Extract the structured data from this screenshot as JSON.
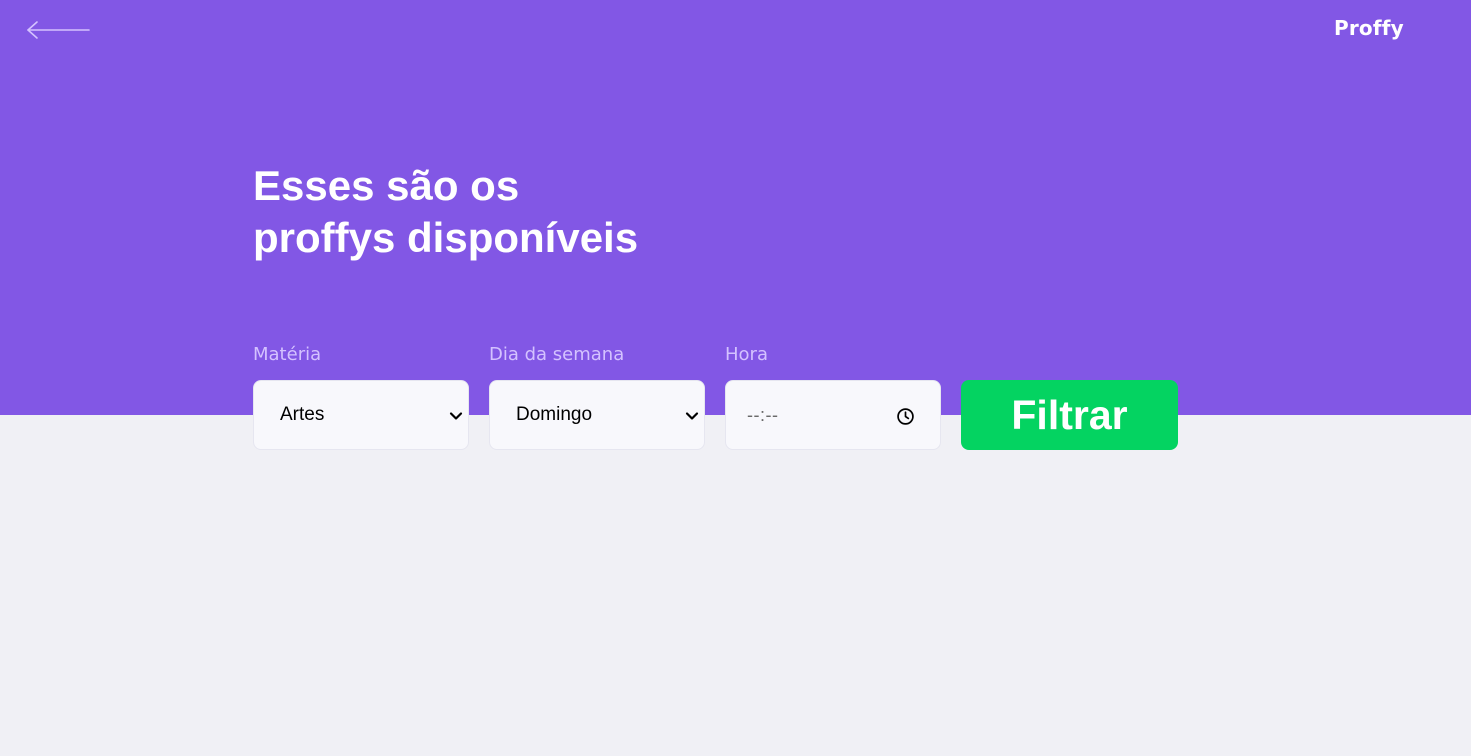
{
  "header": {
    "back_icon": "arrow-left-icon",
    "logo_text": "Proffy",
    "title_line1": "Esses são os",
    "title_line2": "proffys disponíveis"
  },
  "filters": {
    "subject": {
      "label": "Matéria",
      "value": "Artes",
      "icon": "chevron-down-icon"
    },
    "weekday": {
      "label": "Dia da semana",
      "value": "Domingo",
      "icon": "chevron-down-icon"
    },
    "time": {
      "label": "Hora",
      "placeholder": "--:--",
      "icon": "clock-icon"
    },
    "submit_label": "Filtrar"
  },
  "colors": {
    "primary": "#8257E5",
    "background": "#F0F0F5",
    "label": "#D4C2FF",
    "input_bg": "#F8F8FC",
    "button": "#04D361",
    "white": "#FFFFFF"
  }
}
